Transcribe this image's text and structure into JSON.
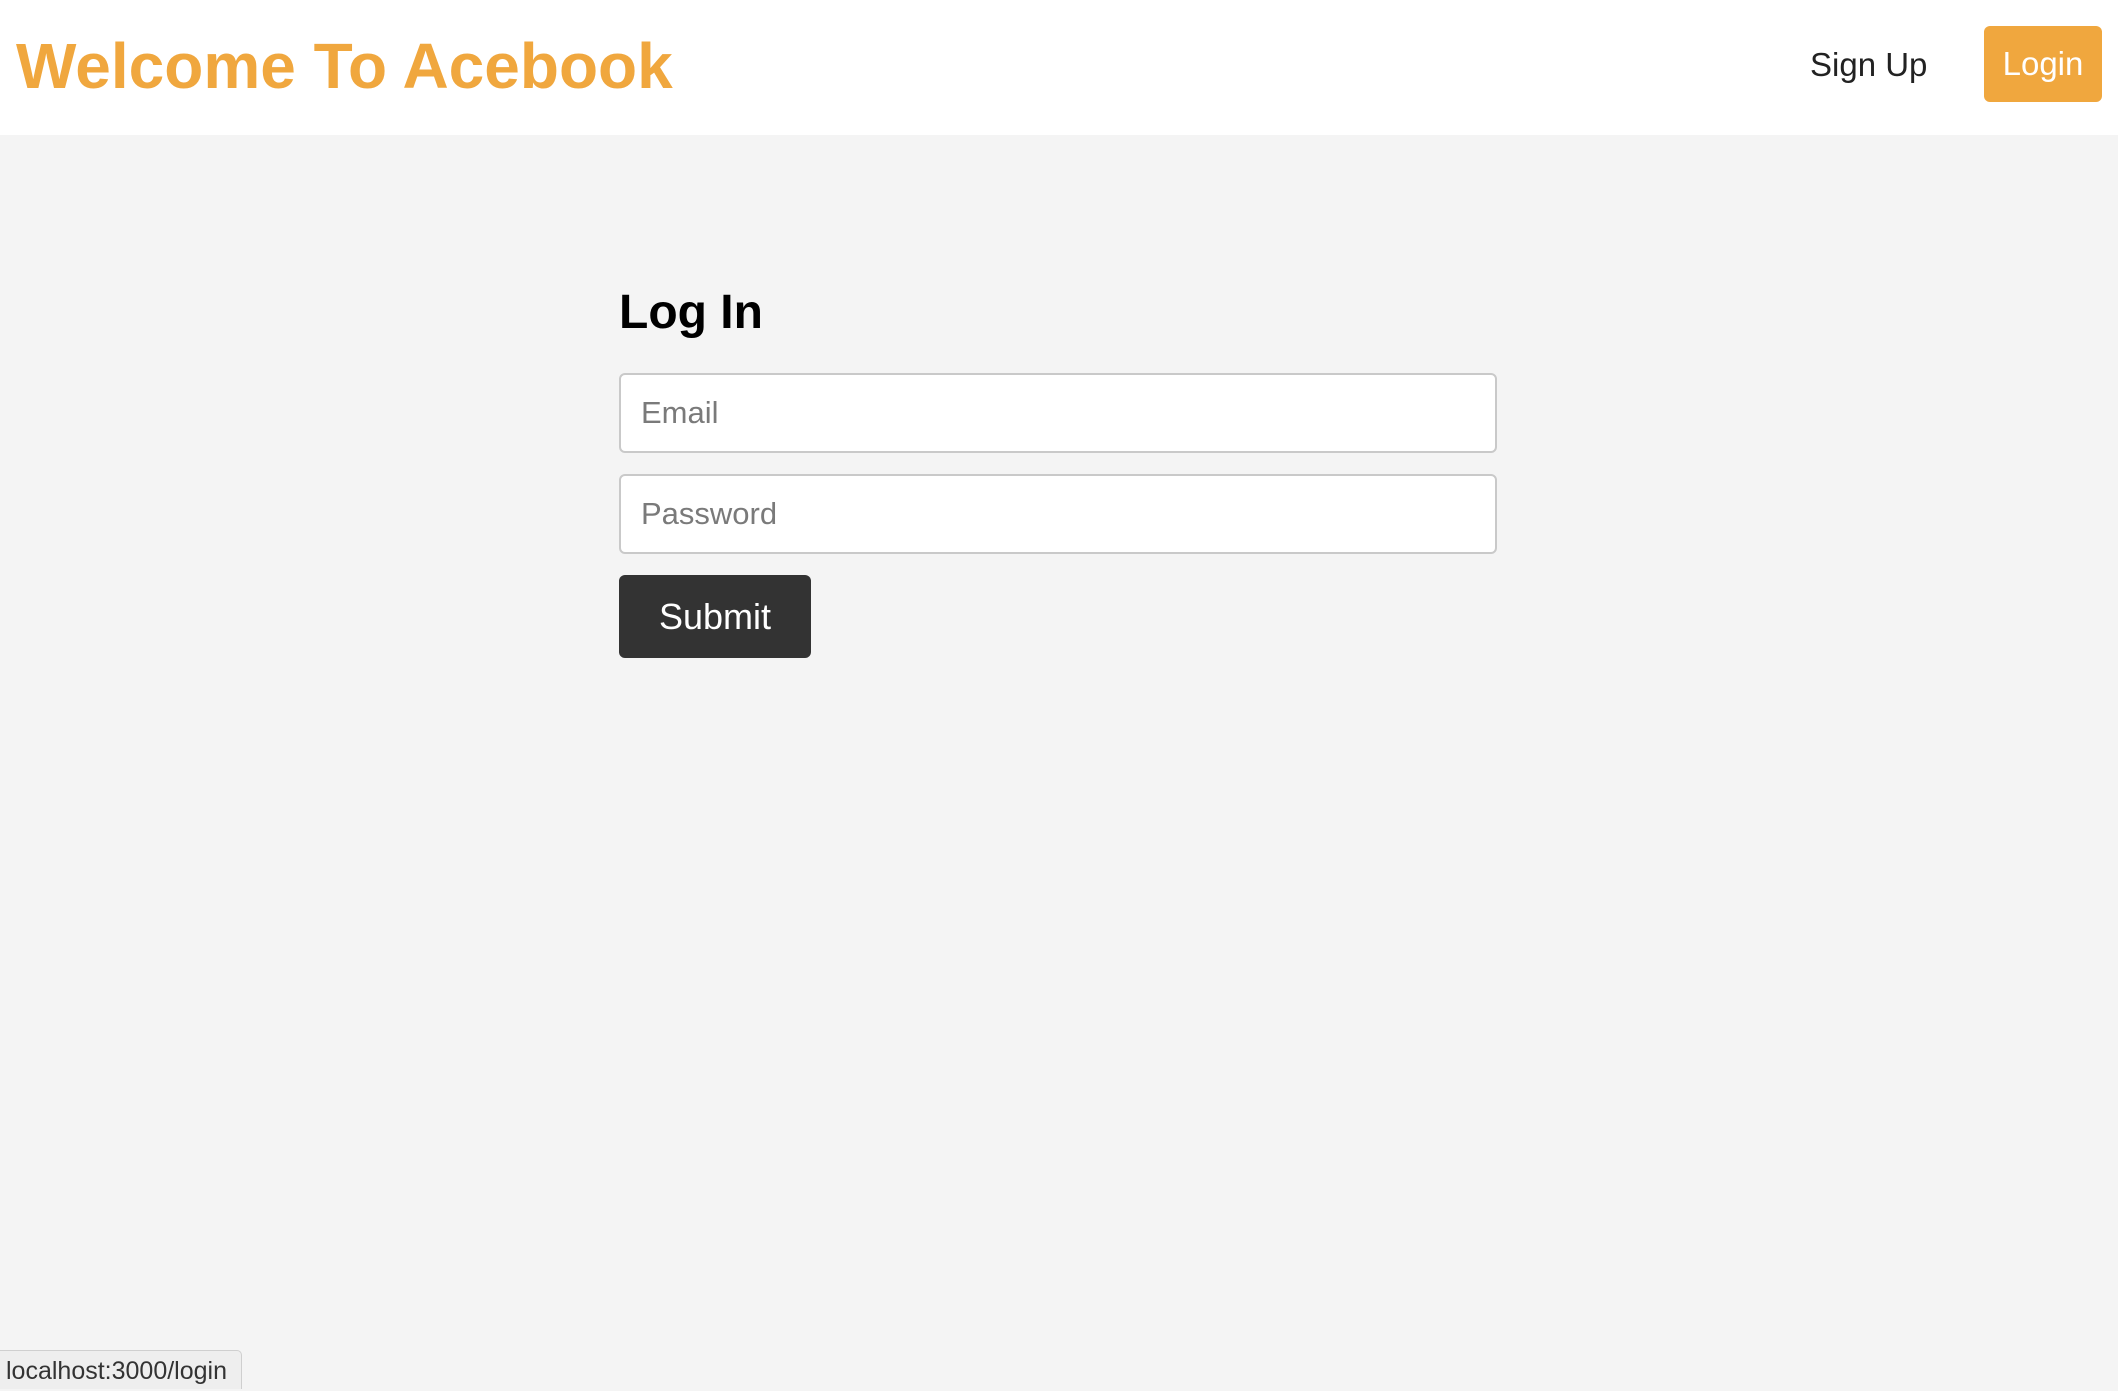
{
  "header": {
    "brand": "Welcome To Acebook",
    "nav": {
      "signup_label": "Sign Up",
      "login_label": "Login"
    }
  },
  "login_form": {
    "heading": "Log In",
    "email": {
      "value": "",
      "placeholder": "Email"
    },
    "password": {
      "value": "",
      "placeholder": "Password"
    },
    "submit_label": "Submit"
  },
  "status_bar": {
    "url": "localhost:3000/login"
  },
  "colors": {
    "brand_accent": "#f0a73e",
    "submit_button": "#333333",
    "page_background": "#f4f4f4",
    "header_background": "#ffffff"
  }
}
